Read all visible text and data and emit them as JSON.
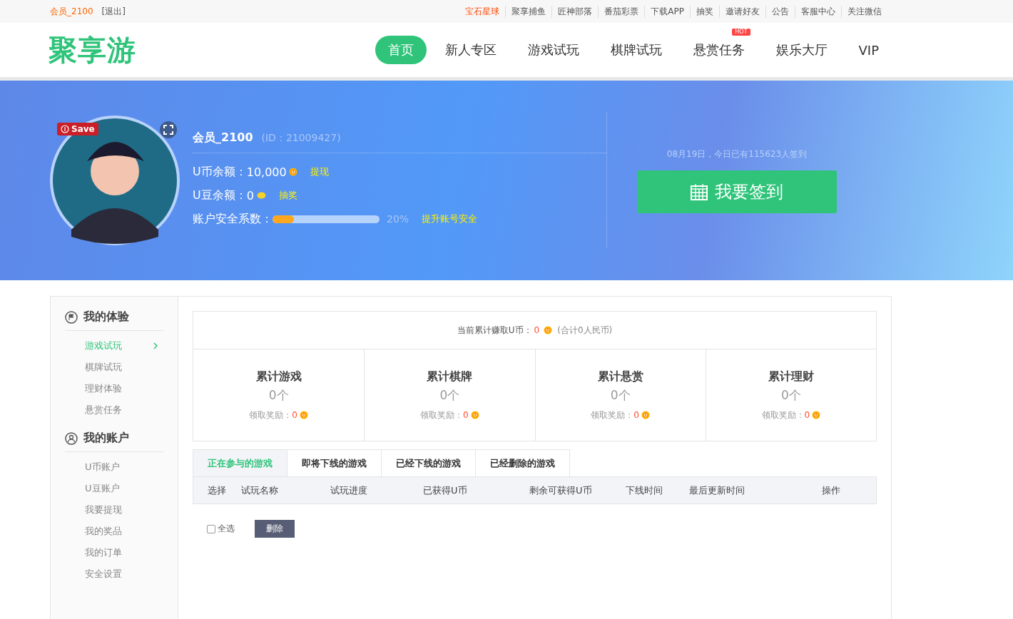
{
  "top_bar": {
    "username": "会员_2100",
    "logout": "[退出]",
    "links": [
      {
        "label": "宝石星球",
        "highlight": true
      },
      {
        "label": "聚享捕鱼",
        "highlight": false
      },
      {
        "label": "匠神部落",
        "highlight": false
      },
      {
        "label": "番茄彩票",
        "highlight": false
      },
      {
        "label": "下载APP",
        "highlight": false
      },
      {
        "label": "抽奖",
        "highlight": false
      },
      {
        "label": "邀请好友",
        "highlight": false
      },
      {
        "label": "公告",
        "highlight": false
      },
      {
        "label": "客服中心",
        "highlight": false
      },
      {
        "label": "关注微信",
        "highlight": false
      }
    ]
  },
  "header": {
    "logo": "聚享游",
    "nav": [
      {
        "label": "首页",
        "selected": true
      },
      {
        "label": "新人专区",
        "selected": false
      },
      {
        "label": "游戏试玩",
        "selected": false
      },
      {
        "label": "棋牌试玩",
        "selected": false
      },
      {
        "label": "悬赏任务",
        "selected": false,
        "badge": "HOT"
      },
      {
        "label": "娱乐大厅",
        "selected": false
      },
      {
        "label": "VIP",
        "selected": false
      }
    ]
  },
  "profile": {
    "save_label": "Save",
    "name": "会员_2100",
    "id": "(ID：21009427)",
    "ucoin_label": "U币余额：",
    "ucoin_value": "10,000",
    "ucoin_link": "提现",
    "ubean_label": "U豆余额：",
    "ubean_value": "0",
    "ubean_link": "抽奖",
    "security_label": "账户安全系数：",
    "security": {
      "level": 0.2
    },
    "security_reading": "20%",
    "security_link": "提升账号安全"
  },
  "checkin": {
    "note": "08月19日，今日已有115623人签到",
    "button": "我要签到"
  },
  "sidebar": {
    "sections": [
      {
        "title": "我的体验",
        "kind": "flag",
        "items": [
          {
            "label": "游戏试玩",
            "selected": true
          },
          {
            "label": "棋牌试玩",
            "selected": false
          },
          {
            "label": "理财体验",
            "selected": false
          },
          {
            "label": "悬赏任务",
            "selected": false
          }
        ]
      },
      {
        "title": "我的账户",
        "kind": "user",
        "items": [
          {
            "label": "U币账户",
            "selected": false
          },
          {
            "label": "U豆账户",
            "selected": false
          },
          {
            "label": "我要提现",
            "selected": false
          },
          {
            "label": "我的奖品",
            "selected": false
          },
          {
            "label": "我的订单",
            "selected": false
          },
          {
            "label": "安全设置",
            "selected": false
          }
        ]
      }
    ]
  },
  "summary": {
    "label": "当前累计赚取U币：",
    "value": "0",
    "note": "(合计0人民币)"
  },
  "stats": [
    {
      "title": "累计游戏",
      "count": "0个",
      "reward_label": "领取奖励：",
      "reward_value": "0"
    },
    {
      "title": "累计棋牌",
      "count": "0个",
      "reward_label": "领取奖励：",
      "reward_value": "0"
    },
    {
      "title": "累计悬赏",
      "count": "0个",
      "reward_label": "领取奖励：",
      "reward_value": "0"
    },
    {
      "title": "累计理财",
      "count": "0个",
      "reward_label": "领取奖励：",
      "reward_value": "0"
    }
  ],
  "tabs": [
    {
      "label": "正在参与的游戏",
      "selected": true
    },
    {
      "label": "即将下线的游戏",
      "selected": false
    },
    {
      "label": "已经下线的游戏",
      "selected": false
    },
    {
      "label": "已经删除的游戏",
      "selected": false
    }
  ],
  "table": {
    "columns": [
      "选择",
      "试玩名称",
      "试玩进度",
      "已获得U币",
      "剩余可获得U币",
      "下线时间",
      "最后更新时间",
      "操作"
    ]
  },
  "footer_actions": {
    "select_all": {
      "label": "全选",
      "checked": false
    },
    "delete": "删除"
  }
}
